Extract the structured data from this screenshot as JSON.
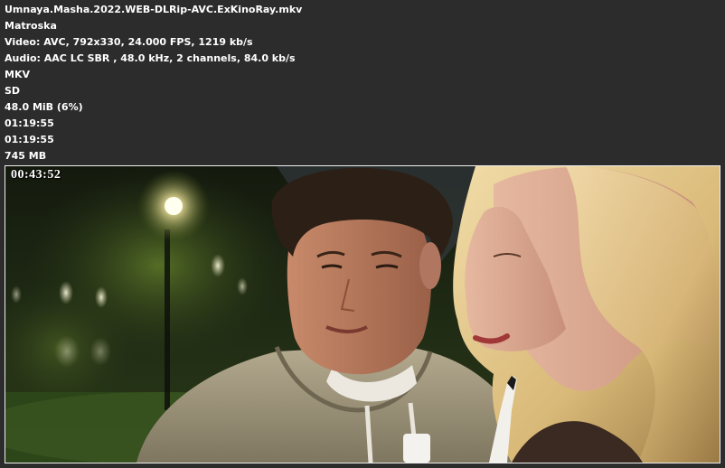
{
  "info": {
    "filename": "Umnaya.Masha.2022.WEB-DLRip-AVC.ExKinoRay.mkv",
    "container": "Matroska",
    "video": "Video: AVC, 792x330, 24.000 FPS, 1219 kb/s",
    "audio": "Audio: AAC LC SBR , 48.0 kHz, 2 channels, 84.0 kb/s",
    "format": "MKV",
    "definition": "SD",
    "audio_size": "48.0 MiB (6%)",
    "duration_1": "01:19:55",
    "duration_2": "01:19:55",
    "file_size": "745 MB"
  },
  "frame": {
    "timestamp": "00:43:52"
  }
}
